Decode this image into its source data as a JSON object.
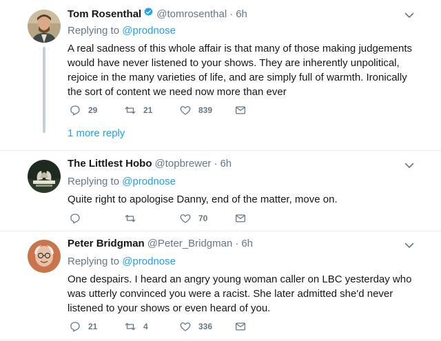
{
  "tweets": [
    {
      "name": "Tom Rosenthal",
      "verified": true,
      "handle": "@tomrosenthal",
      "dot": "·",
      "time": "6h",
      "reply_prefix": "Replying to ",
      "reply_to": "@prodnose",
      "text": "A real sadness of this whole affair is that many of those making judgements would have never listened to your shows. They are inherently unpolitical, rejoice in the many varieties of life, and are simply full of warmth. Ironically the sort of content we need now more than ever",
      "replies": "29",
      "retweets": "21",
      "likes": "839",
      "more_replies": "1 more reply"
    },
    {
      "name": "The Littlest Hobo",
      "verified": false,
      "handle": "@topbrewer",
      "dot": "·",
      "time": "6h",
      "reply_prefix": "Replying to ",
      "reply_to": "@prodnose",
      "text": "Quite right to apologise Danny, end of the matter, move on.",
      "replies": "",
      "retweets": "",
      "likes": "70"
    },
    {
      "name": "Peter Bridgman",
      "verified": false,
      "handle": "@Peter_Bridgman",
      "dot": "·",
      "time": "6h",
      "reply_prefix": "Replying to ",
      "reply_to": "@prodnose",
      "text": "One despairs. I heard an angry young woman caller on LBC yesterday who was utterly convinced you were a racist. She later admitted she'd never listened to your shows or even heard of you.",
      "replies": "21",
      "retweets": "4",
      "likes": "336"
    }
  ],
  "colors": {
    "link": "#1da1f2",
    "muted": "#657786",
    "text": "#14171a",
    "divider": "#e6ecf0",
    "thread_line": "#c4cfd6"
  },
  "icons": [
    "verified-badge-icon",
    "chevron-down-icon",
    "reply-icon",
    "retweet-icon",
    "like-icon",
    "direct-message-icon"
  ]
}
